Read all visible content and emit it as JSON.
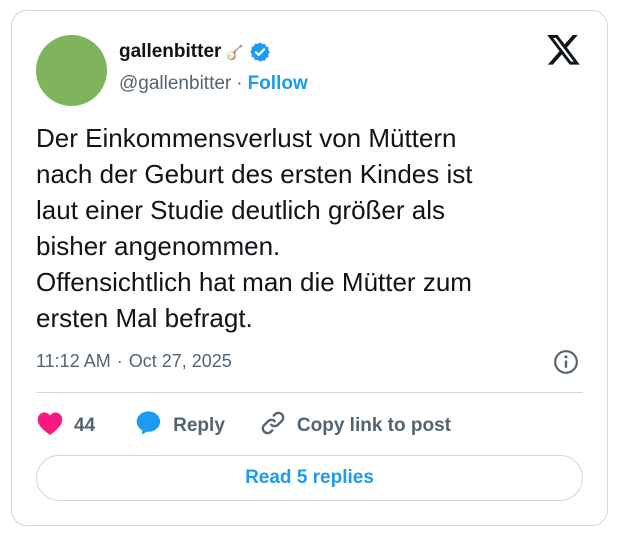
{
  "author": {
    "name": "gallenbitter",
    "name_suffix": "🪕",
    "handle": "@gallenbitter",
    "separator": "·",
    "follow_label": "Follow"
  },
  "tweet": {
    "lines": [
      "Der Einkommensverlust von Müttern",
      "nach der Geburt des ersten Kindes ist",
      "laut einer Studie deutlich größer als",
      "bisher angenommen.",
      "Offensichtlich hat man die Mütter zum",
      "ersten Mal befragt."
    ],
    "time": "11:12 AM",
    "separator": "·",
    "date": "Oct 27, 2025"
  },
  "actions": {
    "like_count": "44",
    "reply_label": "Reply",
    "copy_label": "Copy link to post"
  },
  "read_replies_label": "Read 5 replies",
  "icons": {
    "logo": "x-logo-icon",
    "verified": "verified-badge-icon",
    "info": "info-icon",
    "like": "heart-icon",
    "reply": "reply-bubble-icon",
    "copy": "link-icon"
  },
  "colors": {
    "accent": "#1d9bf0",
    "like": "#f91880",
    "text": "#0f1419",
    "muted": "#536471",
    "avatar": "#7fb35c"
  }
}
